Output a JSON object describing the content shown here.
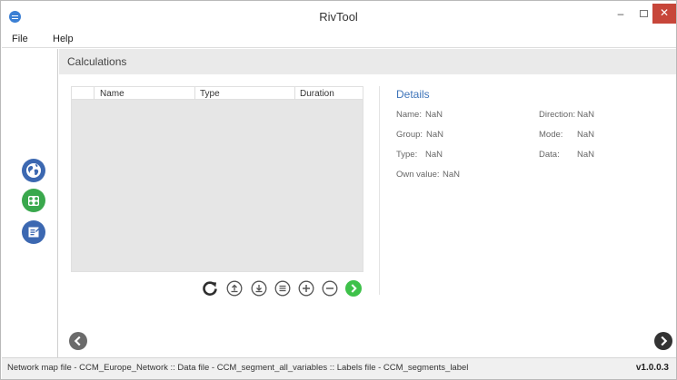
{
  "window": {
    "title": "RivTool",
    "minimize_glyph": "–",
    "close_glyph": "✕"
  },
  "menu": [
    {
      "label": "File"
    },
    {
      "label": "Help"
    }
  ],
  "sidebar": {
    "items": [
      {
        "icon": "globe-icon",
        "color": "#3c68b1"
      },
      {
        "icon": "modules-icon",
        "color": "#3aa84d"
      },
      {
        "icon": "edit-icon",
        "color": "#3c68b1"
      }
    ]
  },
  "section": {
    "title": "Calculations"
  },
  "table": {
    "columns": [
      "Name",
      "Type",
      "Duration"
    ],
    "rows": []
  },
  "toolbar": [
    {
      "icon": "refresh-icon"
    },
    {
      "icon": "upload-icon"
    },
    {
      "icon": "download-icon"
    },
    {
      "icon": "list-icon"
    },
    {
      "icon": "add-icon"
    },
    {
      "icon": "remove-icon"
    },
    {
      "icon": "run-icon",
      "color": "#3ec14a"
    }
  ],
  "details": {
    "title": "Details",
    "fields": [
      {
        "label": "Name:",
        "value": "NaN"
      },
      {
        "label": "Group:",
        "value": "NaN"
      },
      {
        "label": "Type:",
        "value": "NaN"
      },
      {
        "label": "Own value:",
        "value": "NaN"
      },
      {
        "label": "Direction:",
        "value": "NaN"
      },
      {
        "label": "Mode:",
        "value": "NaN"
      },
      {
        "label": "Data:",
        "value": "NaN"
      }
    ]
  },
  "status": {
    "text": "Network map file - CCM_Europe_Network  ::  Data file - CCM_segment_all_variables  ::  Labels file - CCM_segments_label",
    "version": "v1.0.0.3"
  }
}
